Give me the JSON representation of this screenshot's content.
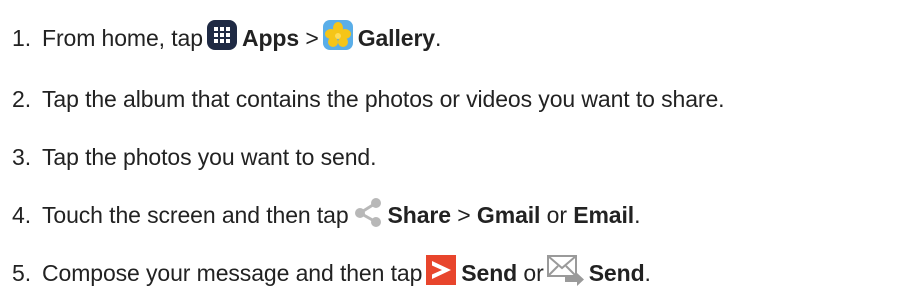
{
  "steps": [
    {
      "number": "1.",
      "text_1": "From home, tap",
      "icon_1": "apps-grid-icon",
      "bold_1": "Apps",
      "text_2": ">",
      "icon_2": "gallery-flower-icon",
      "bold_2": "Gallery",
      "text_3": "."
    },
    {
      "number": "2.",
      "text_1": "Tap the album that contains the photos or videos you want to share."
    },
    {
      "number": "3.",
      "text_1": "Tap the photos you want to send."
    },
    {
      "number": "4.",
      "text_1": "Touch the screen and then tap",
      "icon_1": "share-icon",
      "bold_1": "Share",
      "text_2": ">",
      "bold_2": "Gmail",
      "text_3": "or",
      "bold_3": "Email",
      "text_4": "."
    },
    {
      "number": "5.",
      "text_1": "Compose your message and then tap",
      "icon_1": "send-arrow-icon",
      "bold_1": "Send",
      "text_2": "or",
      "icon_2": "email-send-icon",
      "bold_2": "Send",
      "text_3": "."
    }
  ],
  "colors": {
    "text": "#222222",
    "apps_icon": "#1f2a44",
    "gallery_yellow": "#f5c518",
    "gallery_blue": "#5aaee8",
    "share_icon": "#b8b8b8",
    "send_red": "#e8452c",
    "email_gray": "#9a9a9a"
  }
}
